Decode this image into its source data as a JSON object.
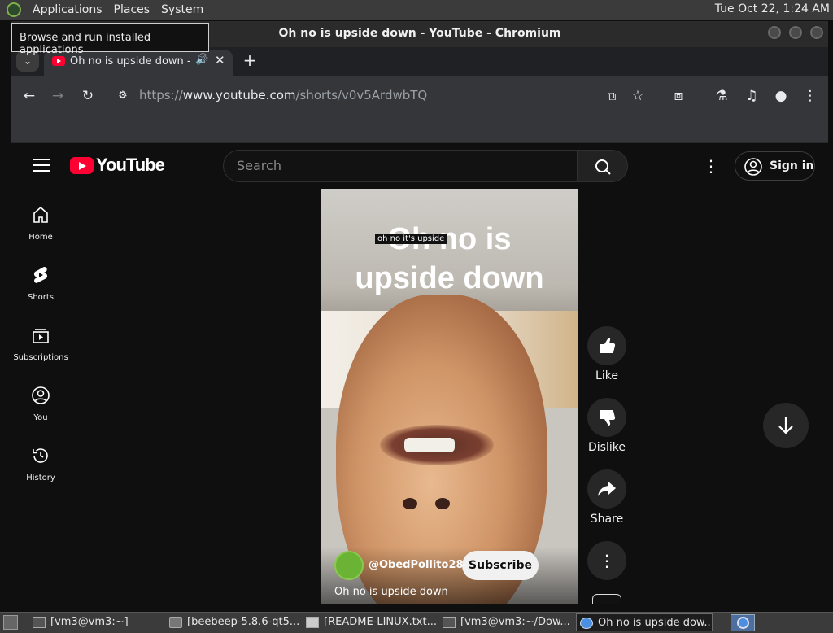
{
  "top_panel": {
    "menus": [
      "Applications",
      "Places",
      "System"
    ],
    "clock": "Tue Oct 22,  1:24 AM",
    "tooltip": "Browse and run installed applications"
  },
  "window": {
    "title": "Oh no is upside down - YouTube - Chromium"
  },
  "browser": {
    "tab_title": "Oh no is upside down - YouTube",
    "address_scheme": "https://",
    "address_host": "www.youtube.com",
    "address_path": "/shorts/v0v5ArdwbTQ"
  },
  "youtube": {
    "logo_text": "YouTube",
    "search_placeholder": "Search",
    "sign_in": "Sign in",
    "sidebar": [
      {
        "label": "Home",
        "icon": "home-icon"
      },
      {
        "label": "Shorts",
        "icon": "shorts-icon"
      },
      {
        "label": "Subscriptions",
        "icon": "subscriptions-icon"
      },
      {
        "label": "You",
        "icon": "you-icon"
      },
      {
        "label": "History",
        "icon": "history-icon"
      }
    ],
    "video": {
      "overlay_line1": "Oh no is",
      "overlay_line2": "upside down",
      "hover_tooltip": "oh no it's upside",
      "channel": "@ObedPollito285",
      "subscribe": "Subscribe",
      "title": "Oh no is upside down"
    },
    "actions": {
      "like": "Like",
      "dislike": "Dislike",
      "share": "Share"
    }
  },
  "taskbar": [
    {
      "label": "[vm3@vm3:~]",
      "icon": "terminal-icon"
    },
    {
      "label": "[beebeep-5.8.6-qt5...",
      "icon": "folder-icon"
    },
    {
      "label": "[README-LINUX.txt....",
      "icon": "text-file-icon"
    },
    {
      "label": "[vm3@vm3:~/Dow...",
      "icon": "terminal-icon"
    },
    {
      "label": "Oh no is upside dow...",
      "icon": "chromium-icon"
    }
  ],
  "colors": {
    "youtube_red": "#ff0033",
    "page_bg": "#0f0f0f",
    "chrome_toolbar": "#35363a"
  }
}
